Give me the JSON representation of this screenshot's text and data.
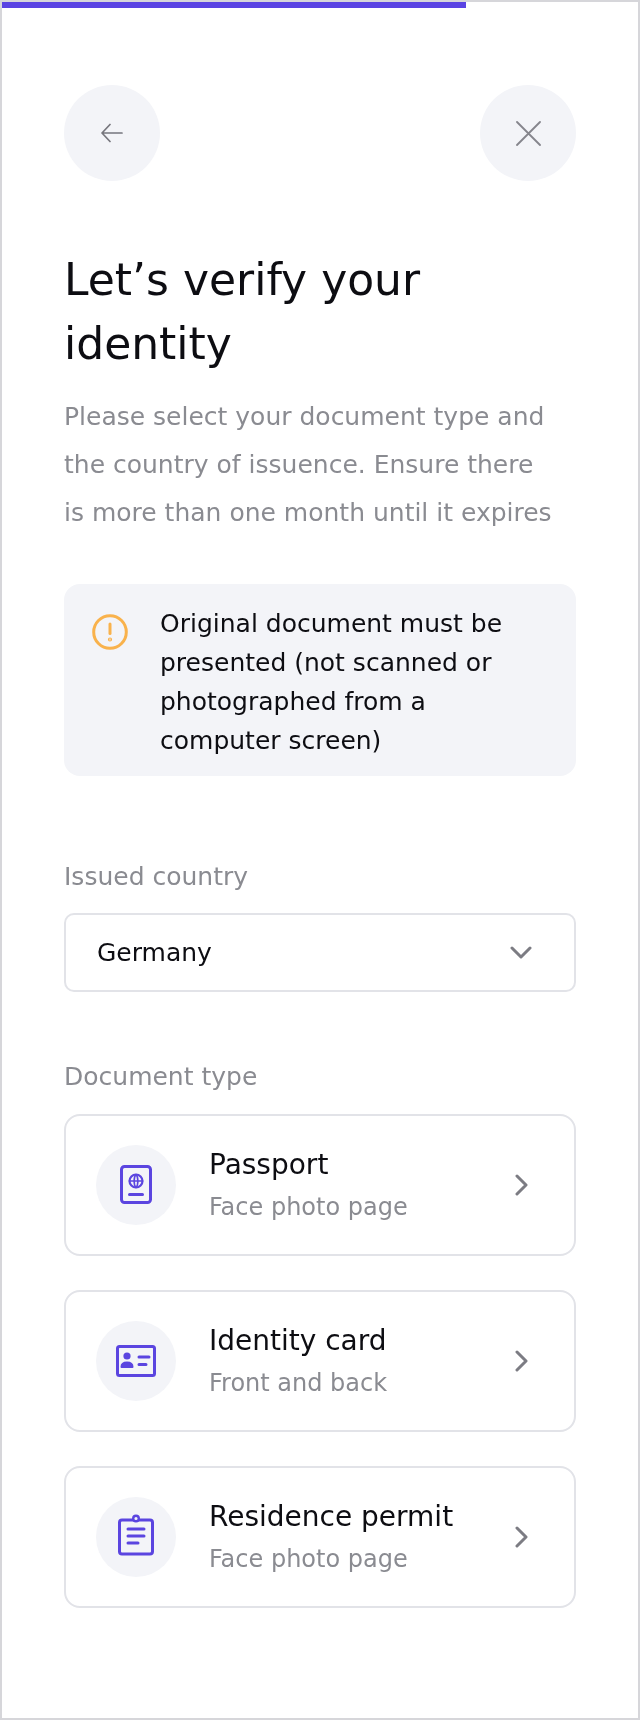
{
  "progress": {
    "level": 0.73
  },
  "title": "Let’s verify your identity",
  "description": "Please select your document type and the country of issuence. Ensure there is more than one month until it expires",
  "notice": {
    "text": "Original document must be presented (not scanned or photographed from a computer screen)"
  },
  "country": {
    "label": "Issued country",
    "value": "Germany"
  },
  "document_type": {
    "label": "Document type",
    "options": [
      {
        "kind": "passport",
        "title": "Passport",
        "subtitle": "Face photo page"
      },
      {
        "kind": "id_card",
        "title": "Identity card",
        "subtitle": "Front and back"
      },
      {
        "kind": "residence_permit",
        "title": "Residence permit",
        "subtitle": "Face photo page"
      }
    ]
  }
}
